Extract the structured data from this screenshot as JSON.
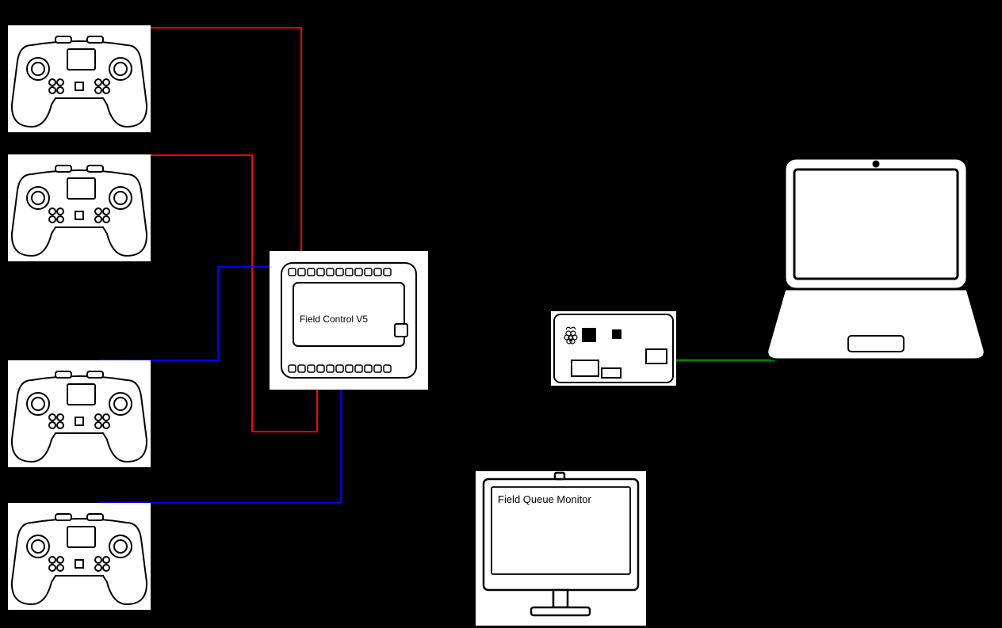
{
  "diagram": {
    "field_control_label": "Field Control V5",
    "monitor_label": "Field Queue Monitor",
    "controllers": [
      "Controller 1",
      "Controller 2",
      "Controller 3",
      "Controller 4"
    ],
    "raspberry_pi": "Raspberry Pi",
    "laptop": "Laptop",
    "wire_colors": {
      "red": "#ff0000",
      "blue": "#0000ff",
      "green": "#008000"
    }
  }
}
